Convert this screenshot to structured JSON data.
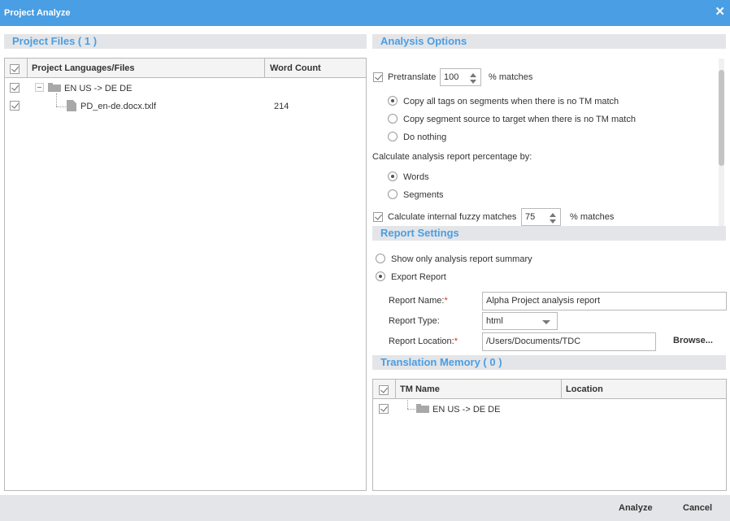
{
  "window": {
    "title": "Project Analyze",
    "close_glyph": "✕"
  },
  "project_files": {
    "header": "Project Files ( 1 )",
    "columns": {
      "name": "Project Languages/Files",
      "word_count": "Word Count"
    },
    "rows": [
      {
        "label": "EN US -> DE DE",
        "word_count": "",
        "checked": true,
        "type": "folder"
      },
      {
        "label": "PD_en-de.docx.txlf",
        "word_count": "214",
        "checked": true,
        "type": "file"
      }
    ]
  },
  "analysis_options": {
    "header": "Analysis Options",
    "pretranslate": {
      "label": "Pretranslate",
      "value": "100",
      "suffix": "% matches",
      "checked": true
    },
    "pretranslate_options": [
      {
        "label": "Copy all tags on segments when there is no TM match",
        "selected": true
      },
      {
        "label": "Copy segment source to target when there is no TM match",
        "selected": false
      },
      {
        "label": "Do nothing",
        "selected": false
      }
    ],
    "percentage_label": "Calculate analysis report percentage by:",
    "percentage_options": [
      {
        "label": "Words",
        "selected": true
      },
      {
        "label": "Segments",
        "selected": false
      }
    ],
    "fuzzy": {
      "label": "Calculate internal fuzzy matches",
      "value": "75",
      "suffix": "% matches",
      "checked": true
    }
  },
  "report_settings": {
    "header": "Report Settings",
    "options": [
      {
        "label": "Show only analysis report summary",
        "selected": false
      },
      {
        "label": "Export Report",
        "selected": true
      }
    ],
    "report_name": {
      "label": "Report Name:",
      "required_mark": "*",
      "value": "Alpha Project analysis report"
    },
    "report_type": {
      "label": "Report Type:",
      "value": "html"
    },
    "report_location": {
      "label": "Report Location:",
      "required_mark": "*",
      "value": "/Users/Documents/TDC"
    },
    "browse_label": "Browse..."
  },
  "translation_memory": {
    "header": "Translation Memory ( 0 )",
    "columns": {
      "name": "TM Name",
      "location": "Location"
    },
    "rows": [
      {
        "label": "EN US -> DE DE",
        "checked": true,
        "type": "folder"
      }
    ]
  },
  "footer": {
    "analyze_label": "Analyze",
    "cancel_label": "Cancel"
  }
}
